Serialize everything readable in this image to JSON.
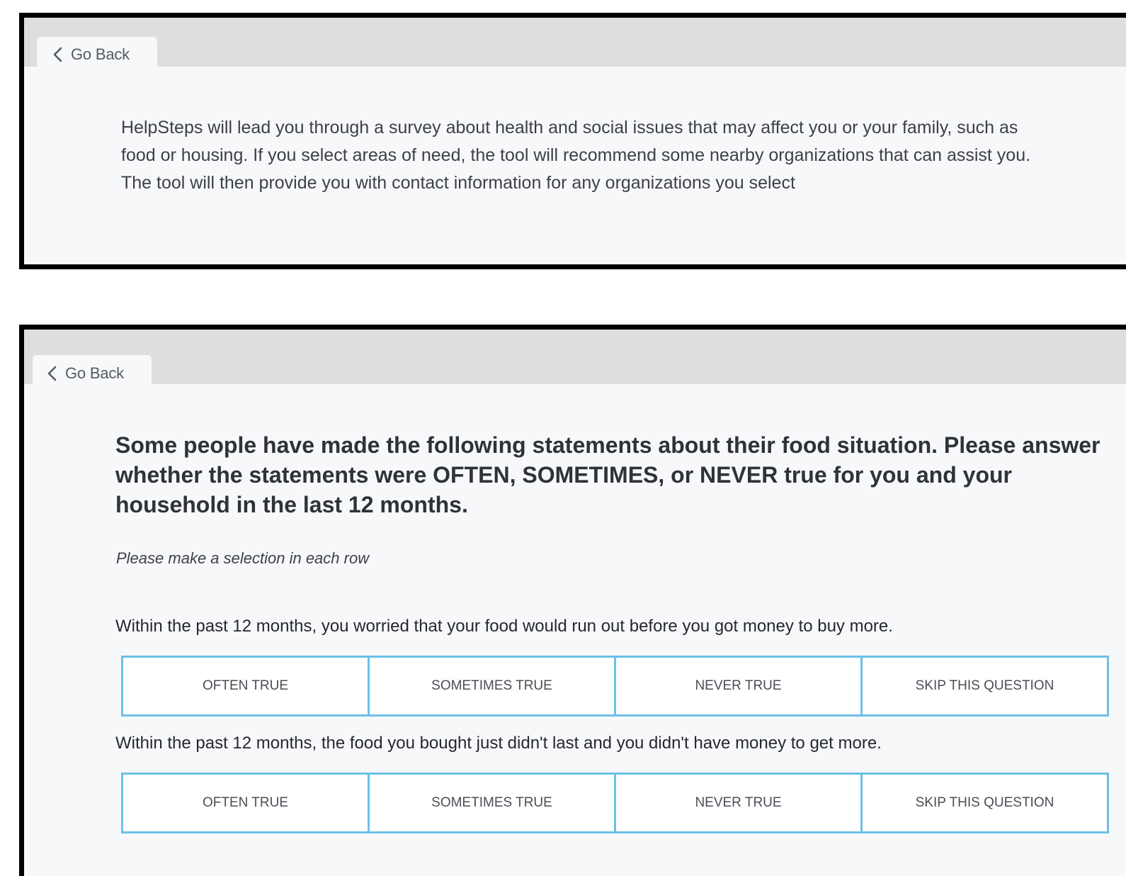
{
  "panel1": {
    "back_label": "Go Back",
    "intro_text": "HelpSteps will lead you through a survey about health and social issues that may affect you or your family, such as\nfood or housing. If you select areas of need, the tool will recommend some nearby organizations that can assist you.\nThe tool will then provide you with contact information for any organizations you select"
  },
  "panel2": {
    "back_label": "Go Back",
    "question_title": "Some people have made the following statements about their food situation. Please answer whether the statements were OFTEN, SOMETIMES, or NEVER true for you and your household in the last 12 months.",
    "hint": "Please make a selection in each row",
    "statements": [
      {
        "text": "Within the past 12 months, you worried that your food would run out before you got money to buy more.",
        "options": [
          "OFTEN TRUE",
          "SOMETIMES TRUE",
          "NEVER TRUE",
          "SKIP THIS QUESTION"
        ]
      },
      {
        "text": "Within the past 12 months, the food you bought just didn't last and you didn't have money to get more.",
        "options": [
          "OFTEN TRUE",
          "SOMETIMES TRUE",
          "NEVER TRUE",
          "SKIP THIS QUESTION"
        ]
      }
    ]
  },
  "colors": {
    "frame_border": "#000000",
    "top_bar": "#dedede",
    "panel_background": "#f7f8fa",
    "choice_border": "#6cc0e8"
  },
  "icons": {
    "back": "chevron-left-icon"
  }
}
